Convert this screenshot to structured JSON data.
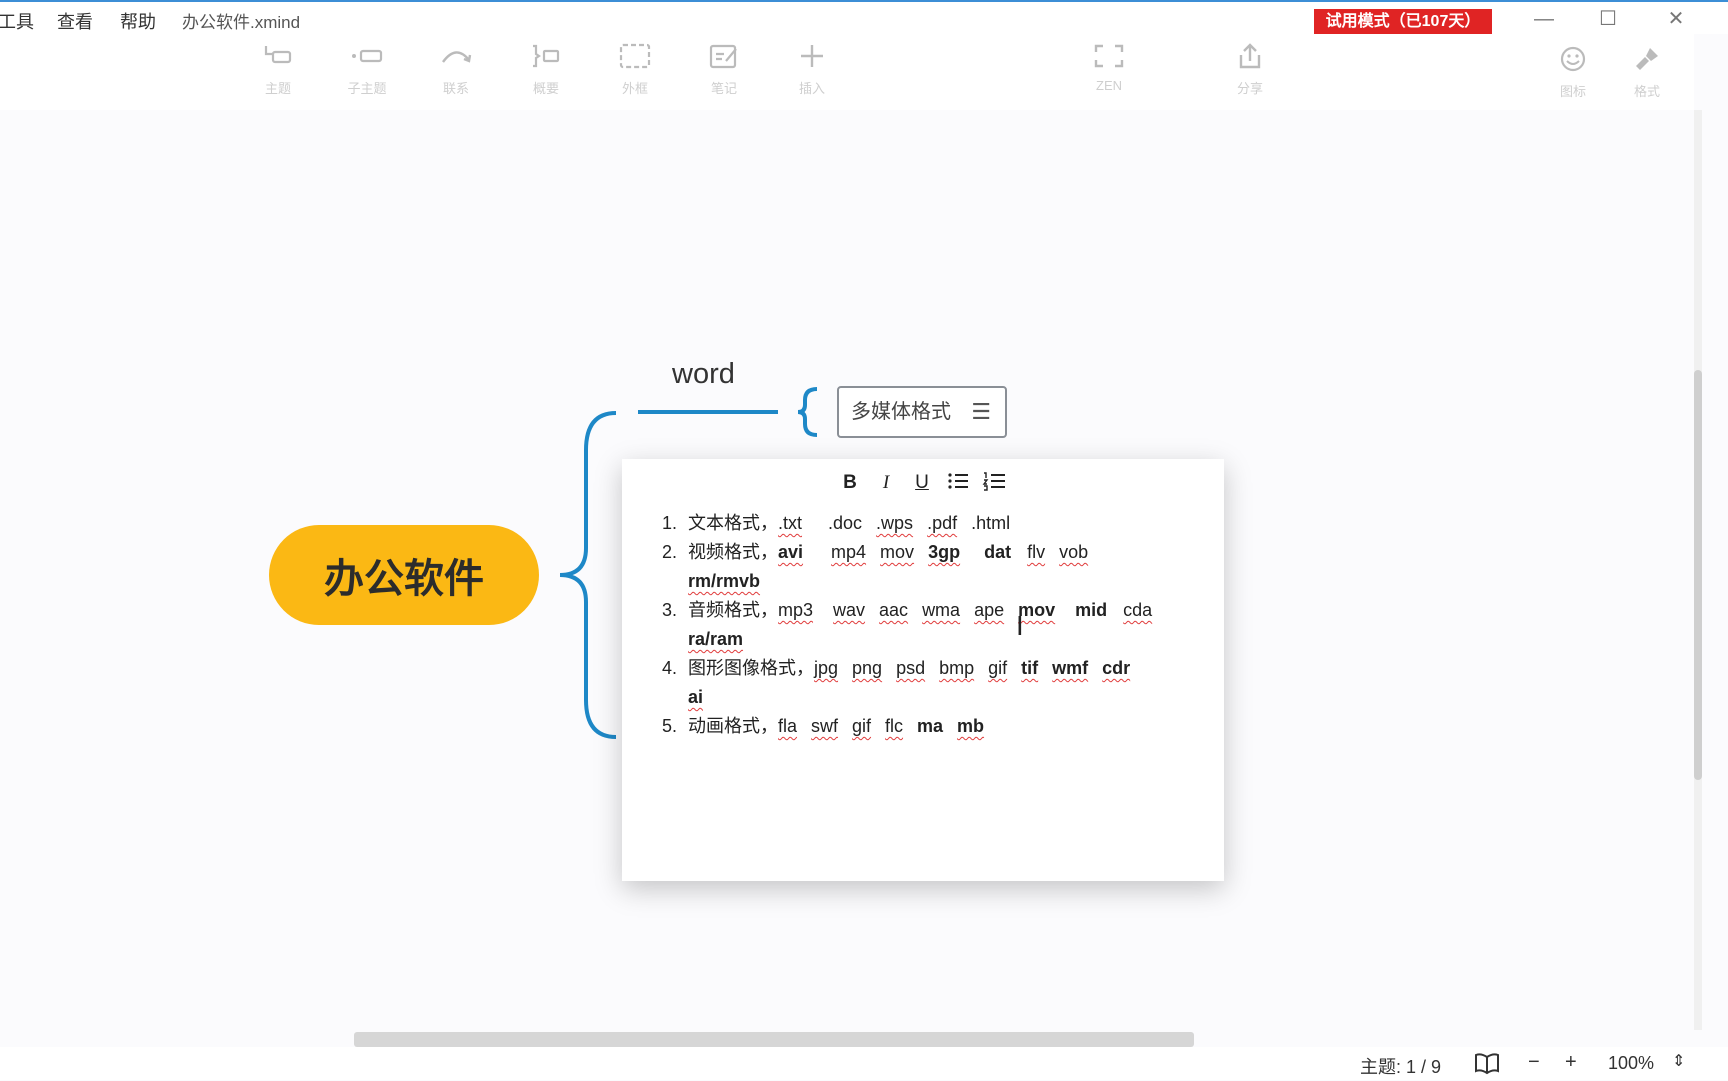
{
  "menu": {
    "tools": "工具",
    "view": "查看",
    "help": "帮助",
    "file_title": "办公软件.xmind"
  },
  "trial_badge": "试用模式（已107天）",
  "window_controls": {
    "minimize": "—",
    "maximize": "☐",
    "close": "✕"
  },
  "toolbar": {
    "items": [
      {
        "label": "主题",
        "icon": "topic-icon"
      },
      {
        "label": "子主题",
        "icon": "subtopic-icon"
      },
      {
        "label": "联系",
        "icon": "relationship-icon"
      },
      {
        "label": "概要",
        "icon": "summary-icon"
      },
      {
        "label": "外框",
        "icon": "boundary-icon"
      },
      {
        "label": "笔记",
        "icon": "note-icon"
      },
      {
        "label": "插入",
        "icon": "plus-icon"
      }
    ],
    "zen": "ZEN",
    "share": "分享",
    "icons_panel": "图标",
    "format_panel": "格式"
  },
  "mindmap": {
    "central_topic": "办公软件",
    "branch_label": "word",
    "topic": "多媒体格式"
  },
  "notes": {
    "format_buttons": {
      "bold": "B",
      "italic": "I",
      "underline": "U"
    },
    "items": [
      {
        "num": "1.",
        "prefix": "文本格式，",
        "tokens": [
          ".txt",
          ".doc",
          ".wps",
          ".pdf",
          ".html"
        ]
      },
      {
        "num": "2.",
        "prefix": "视频格式，",
        "tokens": [
          "avi",
          "mp4",
          "mov",
          "3gp",
          "dat",
          "flv",
          "vob",
          "rm/rmvb"
        ]
      },
      {
        "num": "3.",
        "prefix": "音频格式，",
        "tokens": [
          "mp3",
          "wav",
          "aac",
          "wma",
          "ape",
          "mov",
          "mid",
          "cda",
          "ra/ram"
        ]
      },
      {
        "num": "4.",
        "prefix": "图形图像格式，",
        "tokens": [
          "jpg",
          "png",
          "psd",
          "bmp",
          "gif",
          "tif",
          "wmf",
          "cdr",
          "ai"
        ]
      },
      {
        "num": "5.",
        "prefix": "动画格式，",
        "tokens": [
          "fla",
          "swf",
          "gif",
          "flc",
          "ma",
          "mb"
        ]
      }
    ]
  },
  "status": {
    "topics": "主题: 1 / 9",
    "zoom": "100%",
    "zoom_out": "−",
    "zoom_in": "+"
  }
}
